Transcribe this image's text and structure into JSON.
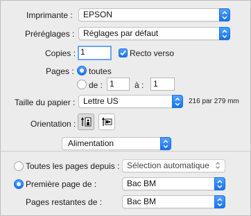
{
  "printer": {
    "label": "Imprimante :",
    "value": "EPSON"
  },
  "presets": {
    "label": "Préréglages :",
    "value": "Réglages par défaut"
  },
  "copies": {
    "label": "Copies :",
    "value": "1",
    "duplex_label": "Recto verso",
    "duplex_checked": true
  },
  "pages": {
    "label": "Pages :",
    "all_label": "toutes",
    "from_label": "de :",
    "from_value": "1",
    "to_label": "à :",
    "to_value": "1",
    "selected": "all"
  },
  "paper_size": {
    "label": "Taille du papier :",
    "value": "Lettre US",
    "dimensions": "216 par 279 mm"
  },
  "orientation": {
    "label": "Orientation :",
    "selected": "portrait",
    "options": [
      "portrait-icon",
      "landscape-icon"
    ]
  },
  "section": {
    "value": "Alimentation"
  },
  "feed": {
    "all_pages_label": "Toutes les pages depuis :",
    "all_pages_value": "Sélection automatique",
    "first_page_label": "Première page de :",
    "first_page_value": "Bac BM",
    "remaining_label": "Pages restantes de :",
    "remaining_value": "Bac BM",
    "selected": "first_page"
  },
  "colors": {
    "accent": "#1a73f0",
    "background": "#ececec",
    "separator": "#cfcfcf"
  }
}
